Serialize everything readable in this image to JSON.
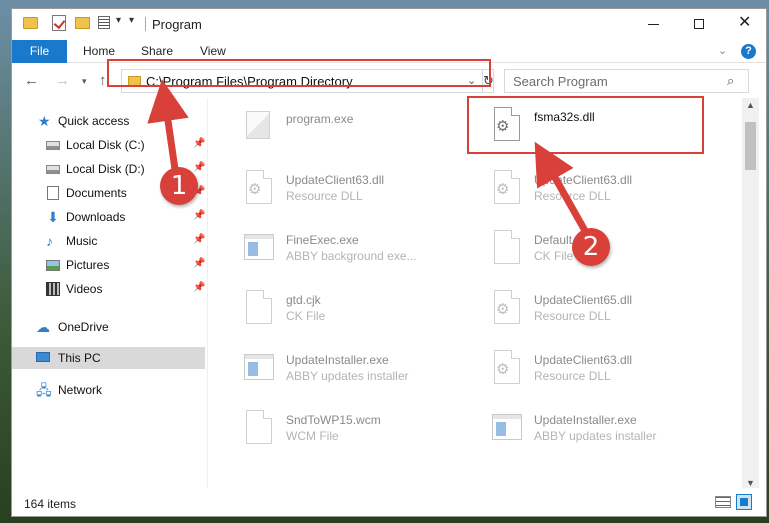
{
  "window": {
    "title": "Program",
    "controls": {
      "minimize": "—",
      "maximize": "☐",
      "close": "✕"
    }
  },
  "ribbon": {
    "file": "File",
    "tabs": [
      "Home",
      "Share",
      "View"
    ],
    "help": "?"
  },
  "nav": {
    "address": "C:\\Program Files\\Program Directory",
    "search_placeholder": "Search Program"
  },
  "sidebar": {
    "items": [
      {
        "label": "Quick access",
        "icon": "star-icon",
        "pinned": false
      },
      {
        "label": "Local Disk (C:)",
        "icon": "disk-icon",
        "pinned": true
      },
      {
        "label": "Local Disk (D:)",
        "icon": "disk-icon",
        "pinned": true
      },
      {
        "label": "Documents",
        "icon": "documents-icon",
        "pinned": true
      },
      {
        "label": "Downloads",
        "icon": "download-icon",
        "pinned": true
      },
      {
        "label": "Music",
        "icon": "music-icon",
        "pinned": true
      },
      {
        "label": "Pictures",
        "icon": "pictures-icon",
        "pinned": true
      },
      {
        "label": "Videos",
        "icon": "videos-icon",
        "pinned": true
      },
      {
        "label": "OneDrive",
        "icon": "cloud-icon",
        "pinned": false
      },
      {
        "label": "This PC",
        "icon": "pc-icon",
        "pinned": false,
        "selected": true
      },
      {
        "label": "Network",
        "icon": "network-icon",
        "pinned": false
      }
    ]
  },
  "files": [
    {
      "name": "program.exe",
      "type": "",
      "icon": "exe-icon"
    },
    {
      "name": "fsma32s.dll",
      "type": "",
      "icon": "dll-gear-icon",
      "highlighted": true
    },
    {
      "name": "UpdateClient63.dll",
      "type": "Resource DLL",
      "icon": "dll-gear-icon"
    },
    {
      "name": "UpdateClient63.dll",
      "type": "Resource DLL",
      "icon": "dll-gear-icon"
    },
    {
      "name": "FineExec.exe",
      "type": "ABBY background exe...",
      "icon": "app-window-icon"
    },
    {
      "name": "Default.dk",
      "type": "CK File",
      "icon": "document-icon"
    },
    {
      "name": "gtd.cjk",
      "type": "CK File",
      "icon": "document-icon"
    },
    {
      "name": "UpdateClient65.dll",
      "type": "Resource DLL",
      "icon": "dll-gear-icon"
    },
    {
      "name": "UpdateInstaller.exe",
      "type": "ABBY updates installer",
      "icon": "app-window-icon"
    },
    {
      "name": "UpdateClient63.dll",
      "type": "Resource DLL",
      "icon": "dll-gear-icon"
    },
    {
      "name": "SndToWP15.wcm",
      "type": "WCM File",
      "icon": "document-icon"
    },
    {
      "name": "UpdateInstaller.exe",
      "type": "ABBY updates installer",
      "icon": "app-window-icon"
    }
  ],
  "status": {
    "item_count": "164 items"
  },
  "annotations": {
    "step1": "1",
    "step2": "2",
    "color": "#d9403a"
  },
  "colors": {
    "accent": "#1979ca",
    "highlight": "#d9403a",
    "selected_bg": "#d9d9d9"
  }
}
